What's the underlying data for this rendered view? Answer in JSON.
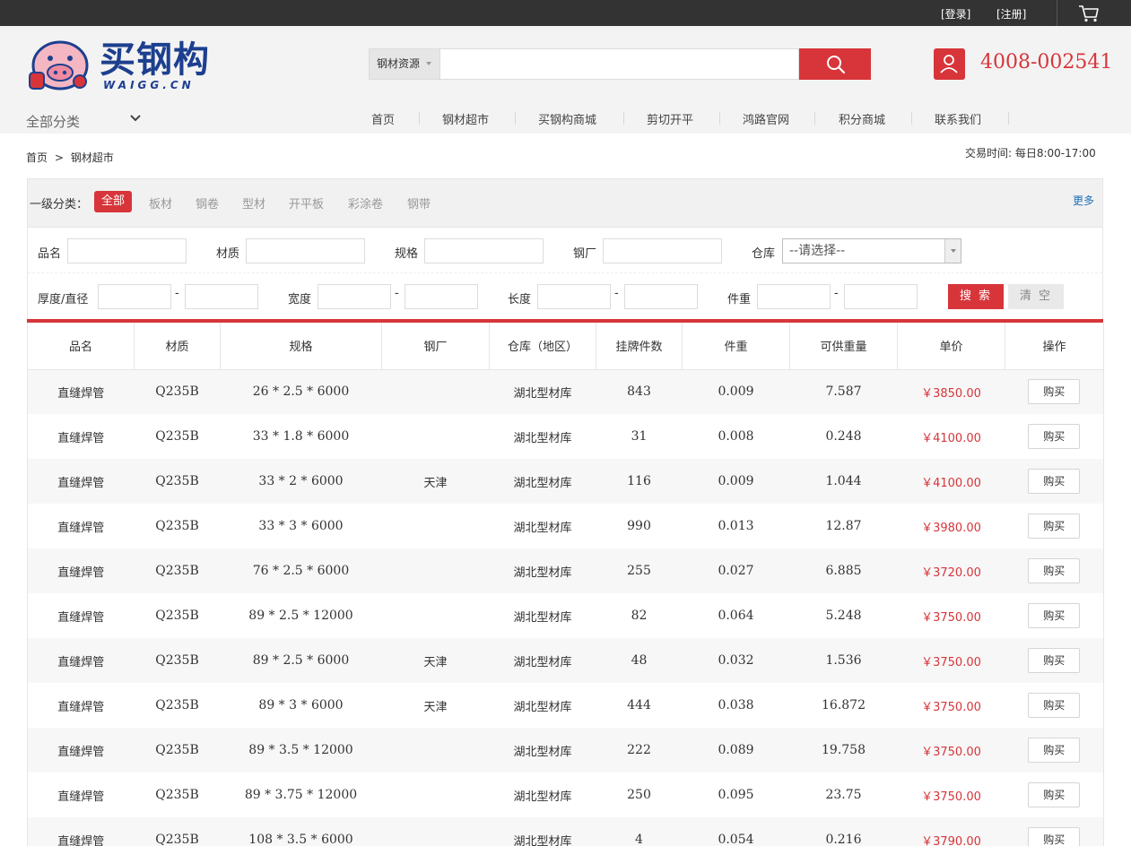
{
  "topbar": {
    "login": "[登录]",
    "register": "[注册]"
  },
  "header": {
    "logo_text": "买钢构",
    "logo_sub": "WAIGG.CN",
    "search_category": "钢材资源",
    "search_placeholder": "",
    "phone": "4008-002541",
    "all_categories": "全部分类",
    "nav": [
      "首页",
      "钢材超市",
      "买钢构商城",
      "剪切开平",
      "鸿路官网",
      "积分商城",
      "联系我们"
    ]
  },
  "breadcrumb": {
    "home": "首页",
    "sep": ">",
    "current": "钢材超市"
  },
  "trade_time": "交易时间:  每日8:00-17:00",
  "filter": {
    "category_label": "一级分类：",
    "categories": [
      "全部",
      "板材",
      "钢卷",
      "型材",
      "开平板",
      "彩涂卷",
      "钢带"
    ],
    "active_category": "全部",
    "more": "更多",
    "name_label": "品名",
    "material_label": "材质",
    "spec_label": "规格",
    "mill_label": "钢厂",
    "warehouse_label": "仓库",
    "warehouse_value": "--请选择--",
    "thickness_label": "厚度/直径",
    "width_label": "宽度",
    "length_label": "长度",
    "weight_label": "件重",
    "dash": "-",
    "search_button": "搜 索",
    "clear_button": "清 空"
  },
  "table": {
    "headers": [
      "品名",
      "材质",
      "规格",
      "钢厂",
      "仓库（地区）",
      "挂牌件数",
      "件重",
      "可供重量",
      "单价",
      "操作"
    ],
    "buy_label": "购买",
    "rows": [
      {
        "name": "直缝焊管",
        "material": "Q235B",
        "spec": "26 * 2.5 * 6000",
        "mill": "",
        "warehouse": "湖北型材库",
        "count": "843",
        "unit_weight": "0.009",
        "available": "7.587",
        "price": "￥3850.00"
      },
      {
        "name": "直缝焊管",
        "material": "Q235B",
        "spec": "33 * 1.8 * 6000",
        "mill": "",
        "warehouse": "湖北型材库",
        "count": "31",
        "unit_weight": "0.008",
        "available": "0.248",
        "price": "￥4100.00"
      },
      {
        "name": "直缝焊管",
        "material": "Q235B",
        "spec": "33 * 2 * 6000",
        "mill": "天津",
        "warehouse": "湖北型材库",
        "count": "116",
        "unit_weight": "0.009",
        "available": "1.044",
        "price": "￥4100.00"
      },
      {
        "name": "直缝焊管",
        "material": "Q235B",
        "spec": "33 * 3 * 6000",
        "mill": "",
        "warehouse": "湖北型材库",
        "count": "990",
        "unit_weight": "0.013",
        "available": "12.87",
        "price": "￥3980.00"
      },
      {
        "name": "直缝焊管",
        "material": "Q235B",
        "spec": "76 * 2.5 * 6000",
        "mill": "",
        "warehouse": "湖北型材库",
        "count": "255",
        "unit_weight": "0.027",
        "available": "6.885",
        "price": "￥3720.00"
      },
      {
        "name": "直缝焊管",
        "material": "Q235B",
        "spec": "89 * 2.5 * 12000",
        "mill": "",
        "warehouse": "湖北型材库",
        "count": "82",
        "unit_weight": "0.064",
        "available": "5.248",
        "price": "￥3750.00"
      },
      {
        "name": "直缝焊管",
        "material": "Q235B",
        "spec": "89 * 2.5 * 6000",
        "mill": "天津",
        "warehouse": "湖北型材库",
        "count": "48",
        "unit_weight": "0.032",
        "available": "1.536",
        "price": "￥3750.00"
      },
      {
        "name": "直缝焊管",
        "material": "Q235B",
        "spec": "89 * 3 * 6000",
        "mill": "天津",
        "warehouse": "湖北型材库",
        "count": "444",
        "unit_weight": "0.038",
        "available": "16.872",
        "price": "￥3750.00"
      },
      {
        "name": "直缝焊管",
        "material": "Q235B",
        "spec": "89 * 3.5 * 12000",
        "mill": "",
        "warehouse": "湖北型材库",
        "count": "222",
        "unit_weight": "0.089",
        "available": "19.758",
        "price": "￥3750.00"
      },
      {
        "name": "直缝焊管",
        "material": "Q235B",
        "spec": "89 * 3.75 * 12000",
        "mill": "",
        "warehouse": "湖北型材库",
        "count": "250",
        "unit_weight": "0.095",
        "available": "23.75",
        "price": "￥3750.00"
      },
      {
        "name": "直缝焊管",
        "material": "Q235B",
        "spec": "108 * 3.5 * 6000",
        "mill": "",
        "warehouse": "湖北型材库",
        "count": "4",
        "unit_weight": "0.054",
        "available": "0.216",
        "price": "￥3790.00"
      }
    ]
  },
  "colors": {
    "brand_red": "#d7353a",
    "logo_blue": "#1d3f8f",
    "topbar": "#333333"
  },
  "icons": [
    "cart-icon",
    "mascot-logo-icon",
    "search-icon",
    "user-phone-icon",
    "chevron-down-icon"
  ]
}
